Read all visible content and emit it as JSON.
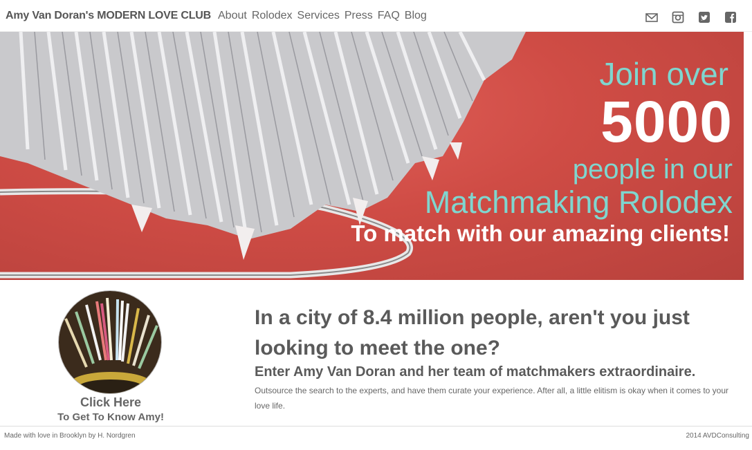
{
  "header": {
    "brand": "Amy Van Doran's MODERN LOVE CLUB",
    "nav": [
      "About",
      "Rolodex",
      "Services",
      "Press",
      "FAQ",
      "Blog"
    ],
    "social_icons": [
      "mail-icon",
      "instagram-icon",
      "twitter-icon",
      "facebook-icon"
    ]
  },
  "hero": {
    "line1": "Join over",
    "number": "5000",
    "line3": "people in our",
    "line4": "Matchmaking Rolodex",
    "line5": "To match with our amazing clients!",
    "accent_color": "#7fd6cf",
    "background_color": "#cf4c45"
  },
  "profile": {
    "cta_title": "Click Here",
    "cta_subtitle": "To Get To Know Amy!"
  },
  "content": {
    "heading": "In a city of 8.4 million people, aren't you just looking to meet the one?",
    "subheading": "Enter Amy Van Doran and her team of matchmakers extraordinaire.",
    "body": "Outsource the search to the experts, and have them curate your experience. After all, a little elitism is okay when it comes to your love life."
  },
  "footer": {
    "left": "Made with love in Brooklyn by H. Nordgren",
    "right": "2014 AVDConsulting"
  }
}
